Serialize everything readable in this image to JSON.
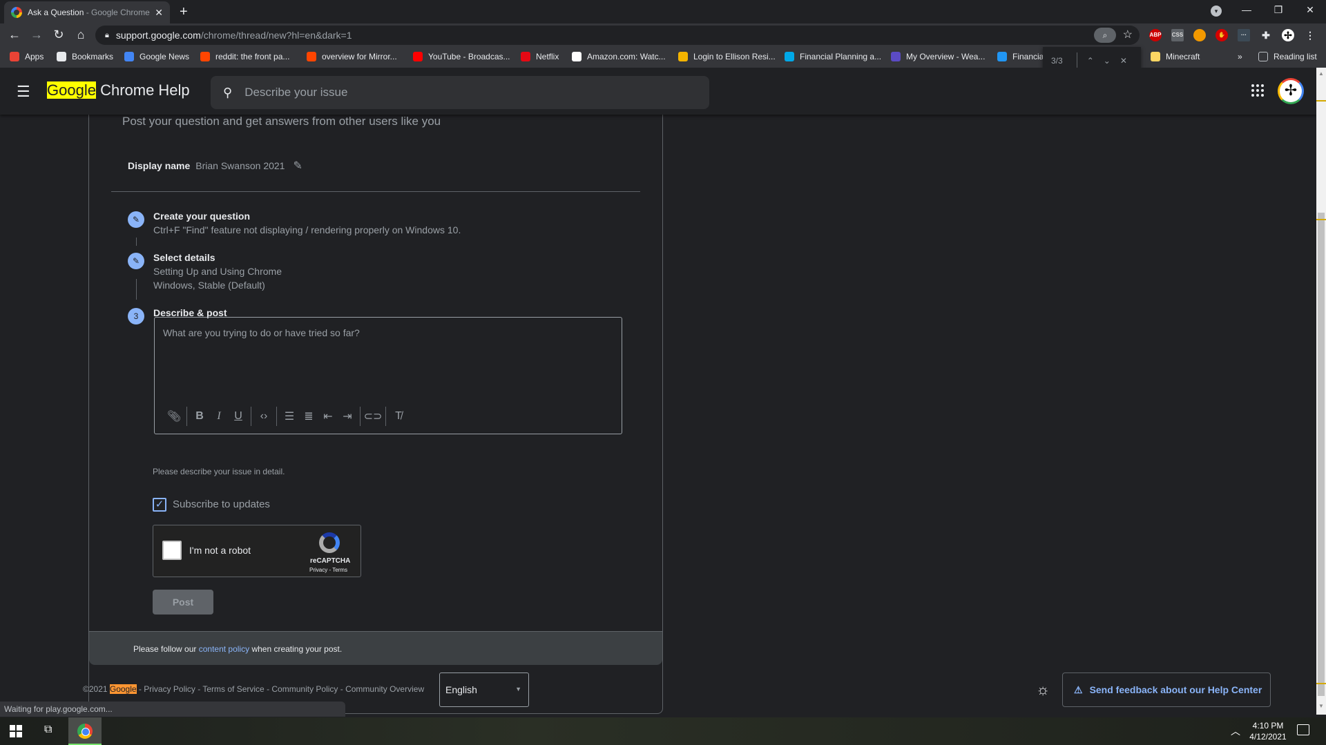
{
  "browser": {
    "tab": {
      "title": "Ask a Question",
      "title_suffix": " - Google Chrome",
      "close": "✕"
    },
    "new_tab": "+",
    "window_controls": {
      "minimize": "—",
      "restore": "❐",
      "close": "✕"
    },
    "url": {
      "host": "support.google.com",
      "path": "/chrome/thread/new?hl=en&dark=1"
    },
    "bookmarks": [
      {
        "label": "Apps",
        "icon": "apps-grid-icon",
        "color": "#ea4335"
      },
      {
        "label": "Bookmarks",
        "icon": "star-icon",
        "color": "#e8eaed"
      },
      {
        "label": "Google News",
        "icon": "google-news-icon",
        "color": "#4285f4"
      },
      {
        "label": "reddit: the front pa...",
        "icon": "reddit-icon",
        "color": "#ff4500"
      },
      {
        "label": "overview for Mirror...",
        "icon": "reddit-icon",
        "color": "#ff4500"
      },
      {
        "label": "YouTube - Broadcas...",
        "icon": "youtube-icon",
        "color": "#ff0000"
      },
      {
        "label": "Netflix",
        "icon": "netflix-icon",
        "color": "#e50914"
      },
      {
        "label": "Amazon.com: Watc...",
        "icon": "amazon-icon",
        "color": "#ffffff"
      },
      {
        "label": "Login to Ellison Resi...",
        "icon": "ellison-icon",
        "color": "#f4b400"
      },
      {
        "label": "Financial Planning a...",
        "icon": "financial-planning-icon",
        "color": "#00a8e8"
      },
      {
        "label": "My Overview - Wea...",
        "icon": "wealth-icon",
        "color": "#5b4bc4"
      },
      {
        "label": "Financia",
        "icon": "financial-icon",
        "color": "#2196f3"
      },
      {
        "label": "Minecraft",
        "icon": "folder-icon",
        "color": "#fdd663"
      }
    ],
    "bookmarks_overflow": "»",
    "reading_list": "Reading list",
    "find_bar": {
      "count": "3/3",
      "prev": "⌃",
      "next": "⌄",
      "close": "✕"
    },
    "status": "Waiting for play.google.com..."
  },
  "header": {
    "logo_highlight": "Google",
    "logo_rest": " Chrome Help",
    "search_placeholder": "Describe your issue"
  },
  "form": {
    "subtitle": "Post your question and get answers from other users like you",
    "display_name_label": "Display name",
    "display_name_value": "Brian Swanson 2021",
    "steps": [
      {
        "number": "✎",
        "title": "Create your question",
        "lines": [
          "Ctrl+F \"Find\" feature not displaying / rendering properly on Windows 10."
        ]
      },
      {
        "number": "✎",
        "title": "Select details",
        "lines": [
          "Setting Up and Using Chrome",
          "Windows, Stable (Default)"
        ]
      },
      {
        "number": "3",
        "title": "Describe & post",
        "lines": []
      }
    ],
    "editor_placeholder": "What are you trying to do or have tried so far?",
    "toolbar": [
      "attach",
      "bold",
      "italic",
      "underline",
      "code",
      "bulleted-list",
      "numbered-list",
      "outdent",
      "indent",
      "link",
      "clear-formatting"
    ],
    "helper_text": "Please describe your issue in detail.",
    "subscribe_label": "Subscribe to updates",
    "subscribe_checked": true,
    "recaptcha": {
      "label": "I'm not a robot",
      "brand": "reCAPTCHA",
      "terms": "Privacy - Terms"
    },
    "post_label": "Post",
    "policy": {
      "before": "Please follow our ",
      "link": "content policy",
      "after": " when creating your post."
    }
  },
  "footer": {
    "copyright": "©2021 ",
    "highlight": "Google",
    "links": " - Privacy Policy - Terms of Service - Community Policy - Community Overview",
    "language": "English",
    "feedback": "Send feedback about our Help Center"
  },
  "taskbar": {
    "time": "4:10 PM",
    "date": "4/12/2021"
  },
  "colors": {
    "accent": "#8ab4f8",
    "find_highlight": "#ffff00",
    "find_current": "#ff9632"
  }
}
